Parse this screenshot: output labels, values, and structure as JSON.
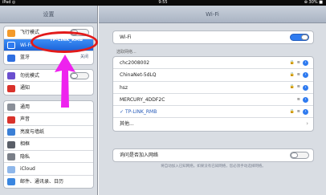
{
  "status": {
    "left": "iPad ◎",
    "time": "9:55",
    "right": "⊕ 30% ■"
  },
  "sidebar": {
    "title": "设置",
    "group1": [
      {
        "label": "飞行模式",
        "toggle": false,
        "icon": "airplane-icon",
        "color": "#f39a2b"
      },
      {
        "label": "Wi-Fi",
        "selected": true,
        "icon": "wifi-icon",
        "color": "#2f7bf0"
      },
      {
        "label": "蓝牙",
        "value": "关闭",
        "icon": "bluetooth-icon",
        "color": "#2f6fe0"
      }
    ],
    "group2": [
      {
        "label": "勿扰模式",
        "toggle": false,
        "icon": "moon-icon",
        "color": "#6a4fcf"
      },
      {
        "label": "通知",
        "icon": "notification-icon",
        "color": "#d9322b"
      }
    ],
    "group3": [
      {
        "label": "通用",
        "icon": "gear-icon",
        "color": "#8a8f98"
      },
      {
        "label": "声音",
        "icon": "sound-icon",
        "color": "#d9322b"
      },
      {
        "label": "亮度与墙纸",
        "icon": "brightness-icon",
        "color": "#3a7fd6"
      },
      {
        "label": "相框",
        "icon": "picture-frame-icon",
        "color": "#5a5f68"
      },
      {
        "label": "隐私",
        "icon": "privacy-icon",
        "color": "#7a7f88"
      },
      {
        "label": "iCloud",
        "icon": "icloud-icon",
        "color": "#8fb7ea"
      },
      {
        "label": "邮件、通讯录、日历",
        "icon": "mail-icon",
        "color": "#3a86e0"
      }
    ]
  },
  "main": {
    "title": "Wi-Fi",
    "wifi_label": "Wi-Fi",
    "wifi_on": true,
    "choose_label": "选取网络...",
    "networks": [
      {
        "name": "chc2008002",
        "lock": true
      },
      {
        "name": "ChinaNet-5dLQ",
        "lock": true
      },
      {
        "name": "hsz",
        "lock": true
      },
      {
        "name": "MERCURY_4DDF2C",
        "lock": false
      },
      {
        "name": "TP-LINK_RMB",
        "lock": true,
        "selected": true
      },
      {
        "name": "其他...",
        "other": true
      }
    ],
    "ask_label": "询问是否加入网络",
    "note": "将自动加入已知网络。如果没有已知网络，您必须手动选择网络。"
  },
  "annotation": {
    "text": "TP-LINK_RMB",
    "oval_color": "#e21a1a",
    "arrow_color": "#ee22ee"
  }
}
